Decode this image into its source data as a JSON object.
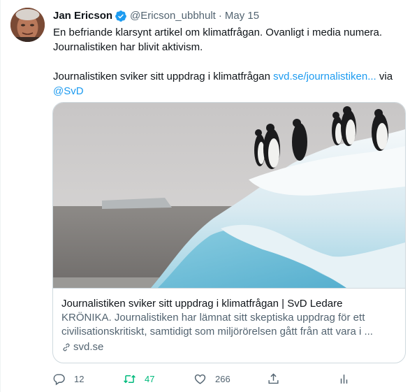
{
  "tweet": {
    "author_name": "Jan Ericson",
    "handle": "@Ericson_ubbhult",
    "separator": "·",
    "date": "May 15",
    "text_line_1": "En befriande klarsynt artikel om klimatfrågan. Ovanligt i media numera. Journalistiken har blivit aktivism.",
    "text_line_2_prefix": "Journalistiken sviker sitt uppdrag i klimatfrågan ",
    "text_link": "svd.se/journalistiken...",
    "text_via": " via",
    "mention": "@SvD"
  },
  "card": {
    "title": "Journalistiken sviker sitt uppdrag i klimatfrågan | SvD Ledare",
    "description": "KRÖNIKA. Journalistiken har lämnat sitt skeptiska uppdrag för ett civilisationskritiskt, samtidigt som miljörörelsen gått från att vara i ...",
    "domain": "svd.se"
  },
  "actions": {
    "replies": "12",
    "retweets": "47",
    "likes": "266"
  },
  "colors": {
    "accent": "#1d9bf0",
    "retweet_active": "#00ba7c",
    "secondary_text": "#536471"
  },
  "icons": [
    "verified-badge-icon",
    "link-icon",
    "reply-icon",
    "retweet-icon",
    "like-icon",
    "share-icon",
    "analytics-icon"
  ]
}
